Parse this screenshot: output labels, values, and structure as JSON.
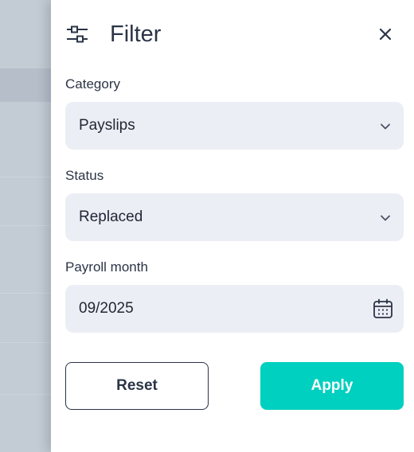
{
  "header": {
    "title": "Filter",
    "filter_icon": "sliders-icon",
    "close_icon": "close-icon"
  },
  "fields": {
    "category": {
      "label": "Category",
      "value": "Payslips",
      "icon": "chevron-down-icon"
    },
    "status": {
      "label": "Status",
      "value": "Replaced",
      "icon": "chevron-down-icon"
    },
    "payroll_month": {
      "label": "Payroll month",
      "value": "09/2025",
      "icon": "calendar-icon"
    }
  },
  "buttons": {
    "reset": "Reset",
    "apply": "Apply"
  },
  "colors": {
    "accent": "#00d0bf",
    "text": "#2b3446",
    "field_bg": "#eceef5"
  }
}
